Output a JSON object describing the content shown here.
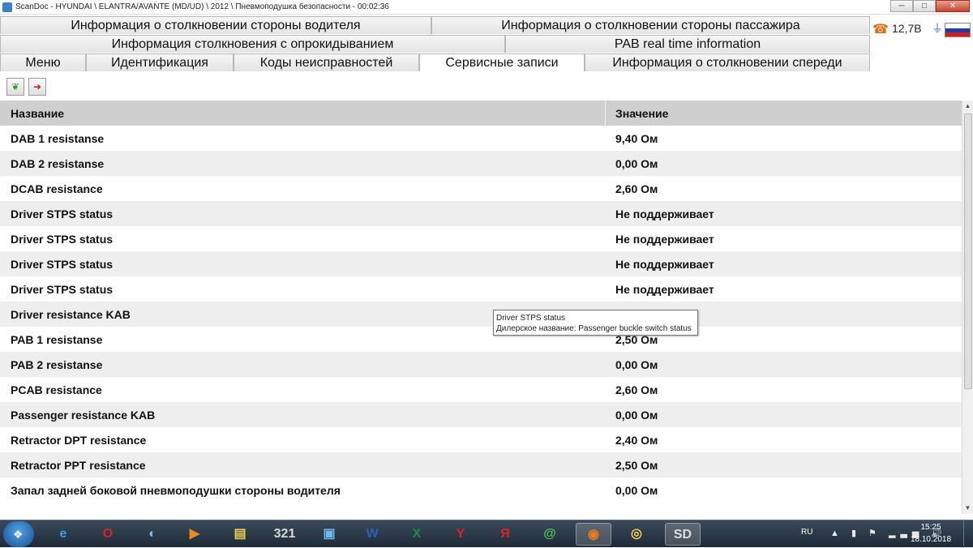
{
  "window": {
    "title": "ScanDoc - HYUNDAI \\ ELANTRA/AVANTE (MD/UD) \\ 2012 \\ Пневмоподушка безопасности - 00:02:36",
    "buttons": {
      "minimize": "─",
      "maximize": "□",
      "close": "✕"
    }
  },
  "tabs": {
    "row1": [
      "Информация о столкновении стороны водителя",
      "Информация о столкновении стороны пассажира"
    ],
    "row2": [
      "Информация столкновения с опрокидыванием",
      "PAB real time information"
    ],
    "row3": [
      "Меню",
      "Идентификация",
      "Коды неисправностей",
      "Сервисные записи",
      "Информация о столкновении спереди"
    ],
    "active": "Сервисные записи"
  },
  "status": {
    "phone_icon": "☎",
    "voltage": "12,7В",
    "plug_icon": "🔌",
    "flag": "russian-flag",
    "flag_colors": [
      "#ffffff",
      "#1b3fb0",
      "#d71a1a"
    ]
  },
  "toolbar": {
    "leaf_button": "leaf-icon",
    "exit_button": "exit-arrow-icon"
  },
  "table": {
    "headers": {
      "name": "Название",
      "value": "Значение"
    },
    "rows": [
      {
        "name": "DAB 1 resistanse",
        "value": "9,40 Ом"
      },
      {
        "name": "DAB 2 resistanse",
        "value": "0,00 Ом"
      },
      {
        "name": "DCAB resistance",
        "value": "2,60 Ом"
      },
      {
        "name": "Driver STPS status",
        "value": "Не поддерживает"
      },
      {
        "name": "Driver STPS status",
        "value": "Не поддерживает"
      },
      {
        "name": "Driver STPS status",
        "value": "Не поддерживает"
      },
      {
        "name": "Driver STPS status",
        "value": "Не поддерживает"
      },
      {
        "name": "Driver resistance KAB",
        "value": "0,00 Ом"
      },
      {
        "name": "PAB 1 resistanse",
        "value": "2,50 Ом"
      },
      {
        "name": "PAB 2 resistanse",
        "value": "0,00 Ом"
      },
      {
        "name": "PCAB resistance",
        "value": "2,60 Ом"
      },
      {
        "name": "Passenger resistance KAB",
        "value": "0,00 Ом"
      },
      {
        "name": "Retractor DPT resistance",
        "value": "2,40 Ом"
      },
      {
        "name": "Retractor PPT resistance",
        "value": "2,50 Ом"
      },
      {
        "name": "Запал задней боковой пневмоподушки стороны водителя",
        "value": "0,00 Ом"
      }
    ]
  },
  "tooltip": {
    "line1": "Driver STPS status",
    "line2": "Дилерское название: Passenger buckle switch status"
  },
  "taskbar": {
    "start_icon": "windows-logo-icon",
    "apps": [
      {
        "name": "ie",
        "glyph": "e",
        "color": "#3aa0e8"
      },
      {
        "name": "opera",
        "glyph": "O",
        "color": "#e0231f"
      },
      {
        "name": "network",
        "glyph": "◐",
        "color": "#7ab8e8"
      },
      {
        "name": "media",
        "glyph": "▶",
        "color": "#f08a1e"
      },
      {
        "name": "folder",
        "glyph": "▤",
        "color": "#f2c94c"
      },
      {
        "name": "player321",
        "glyph": "321",
        "color": "#d8d8d8"
      },
      {
        "name": "monitor",
        "glyph": "▣",
        "color": "#6fb7e8"
      },
      {
        "name": "word",
        "glyph": "W",
        "color": "#2b5fb4"
      },
      {
        "name": "excel",
        "glyph": "X",
        "color": "#1e8a3c"
      },
      {
        "name": "yandex",
        "glyph": "Y",
        "color": "#e0231f"
      },
      {
        "name": "yandex-ya",
        "glyph": "Я",
        "color": "#e0231f"
      },
      {
        "name": "mail",
        "glyph": "@",
        "color": "#4fc24f"
      },
      {
        "name": "firefox",
        "glyph": "◉",
        "color": "#f07a1a"
      },
      {
        "name": "chrome",
        "glyph": "◎",
        "color": "#f2c94c"
      },
      {
        "name": "scandoc",
        "glyph": "SD",
        "color": "#dddddd"
      }
    ],
    "lang": "RU",
    "tray_icons": "▲ ▮ ⚑ ▂▃▅ 🔊",
    "time": "15:25",
    "date": "18.10.2018"
  }
}
